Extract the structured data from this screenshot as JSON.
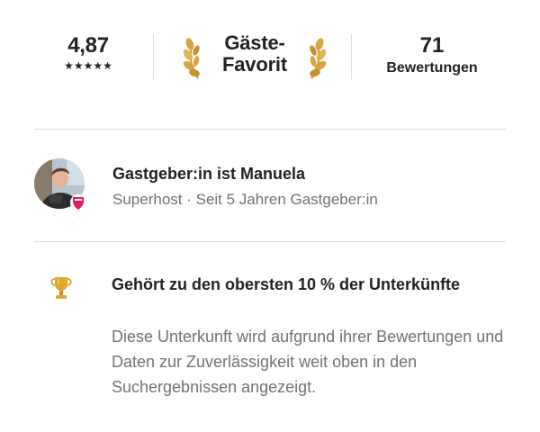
{
  "stats": {
    "rating": "4,87",
    "stars": "★★★★★",
    "star_count": 5,
    "badge_line1": "Gäste-",
    "badge_line2": "Favorit",
    "reviews_count": "71",
    "reviews_label": "Bewertungen"
  },
  "host": {
    "title": "Gastgeber:in ist Manuela",
    "subtitle": "Superhost · Seit 5 Jahren Gastgeber:in",
    "superhost_badge_color": "#e31c5f"
  },
  "highlight": {
    "icon": "trophy-icon",
    "title": "Gehört zu den obersten 10 % der Unterkünfte",
    "body": "Diese Unterkunft wird aufgrund ihrer Bewertungen und Daten zur Zuverlässigkeit weit oben in den Suchergebnissen angezeigt."
  },
  "colors": {
    "text_primary": "#222222",
    "text_secondary": "#717171",
    "divider": "#dddddd",
    "laurel_gold": "#d9a441",
    "trophy_gold": "#e0a82e"
  }
}
